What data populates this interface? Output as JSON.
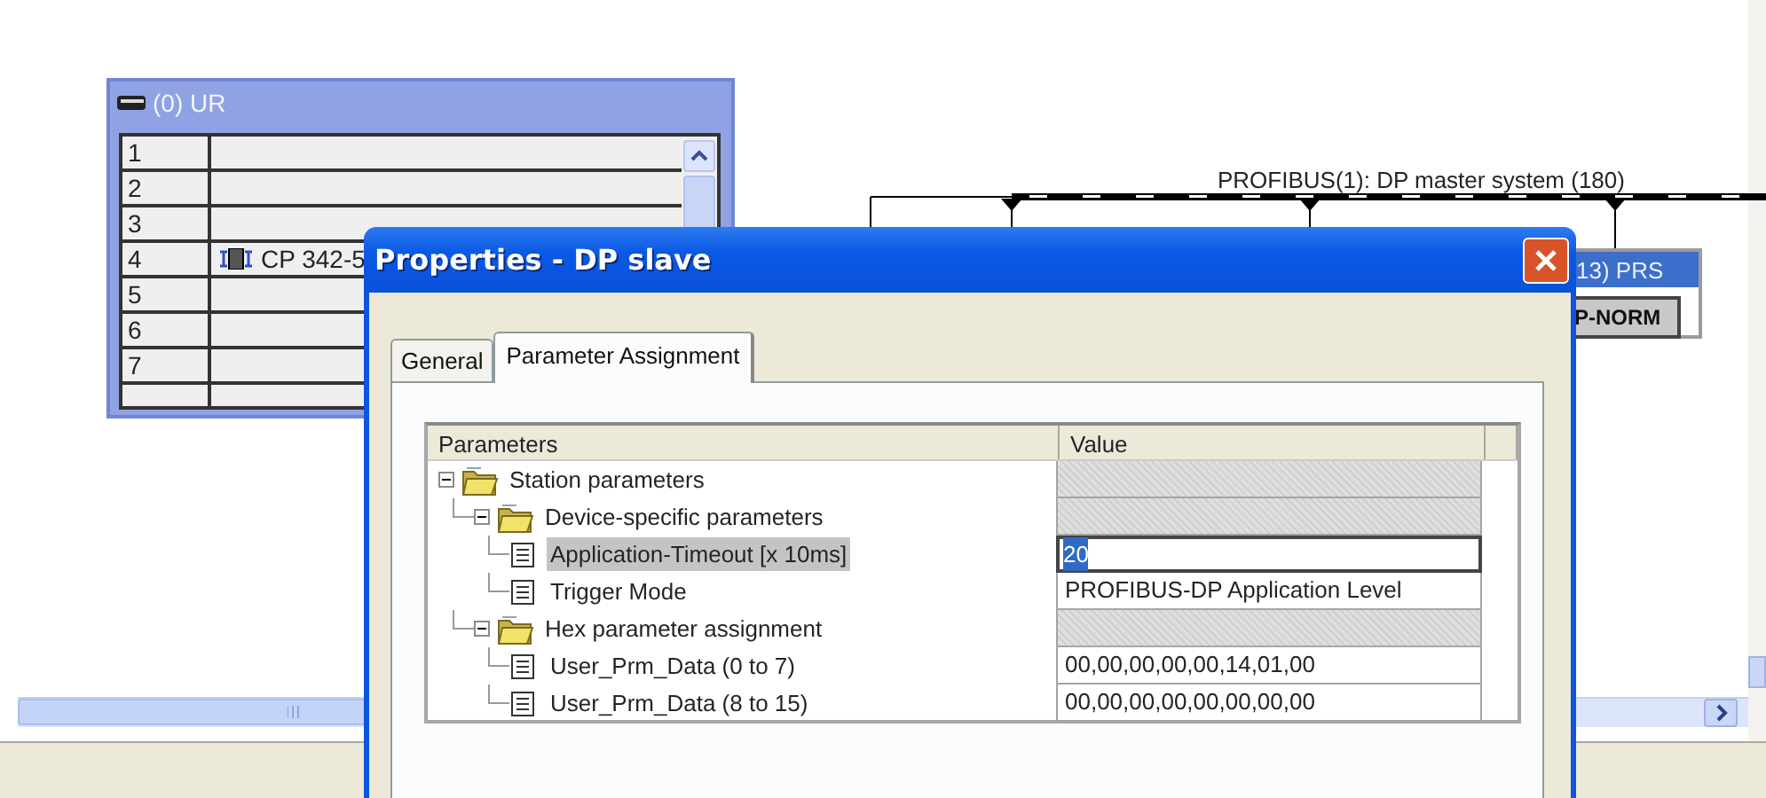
{
  "rack": {
    "title": "(0) UR",
    "slots": [
      {
        "slot": "1"
      },
      {
        "slot": "2"
      },
      {
        "slot": "3"
      },
      {
        "slot": "4",
        "module": "CP 342-5"
      },
      {
        "slot": "5"
      },
      {
        "slot": "6"
      },
      {
        "slot": "7"
      }
    ]
  },
  "network": {
    "label": "PROFIBUS(1): DP master system (180)"
  },
  "slave_box": {
    "title": "13) PRS",
    "button": "P-NORM"
  },
  "dialog": {
    "title": "Properties - DP slave",
    "tabs": [
      {
        "label": "General",
        "selected": false
      },
      {
        "label": "Parameter Assignment",
        "selected": true
      }
    ],
    "columns": [
      "Parameters",
      "Value"
    ],
    "tree": [
      {
        "kind": "folder",
        "label": "Station parameters",
        "expanded": true,
        "selected": false,
        "children": [
          {
            "kind": "folder",
            "label": "Device-specific parameters",
            "expanded": true,
            "selected": false,
            "children": [
              {
                "kind": "parameter",
                "label": "Application-Timeout [x 10ms]",
                "value": "20",
                "selected": true
              },
              {
                "kind": "parameter",
                "label": "Trigger Mode",
                "value": "PROFIBUS-DP Application Level",
                "selected": false
              }
            ]
          },
          {
            "kind": "folder",
            "label": "Hex parameter assignment",
            "expanded": true,
            "selected": false,
            "children": [
              {
                "kind": "parameter",
                "label": "User_Prm_Data (0 to 7)",
                "value": "00,00,00,00,00,14,01,00",
                "selected": false
              },
              {
                "kind": "parameter",
                "label": "User_Prm_Data (8 to 15)",
                "value": "00,00,00,00,00,00,00,00",
                "selected": false
              }
            ]
          }
        ]
      }
    ]
  }
}
